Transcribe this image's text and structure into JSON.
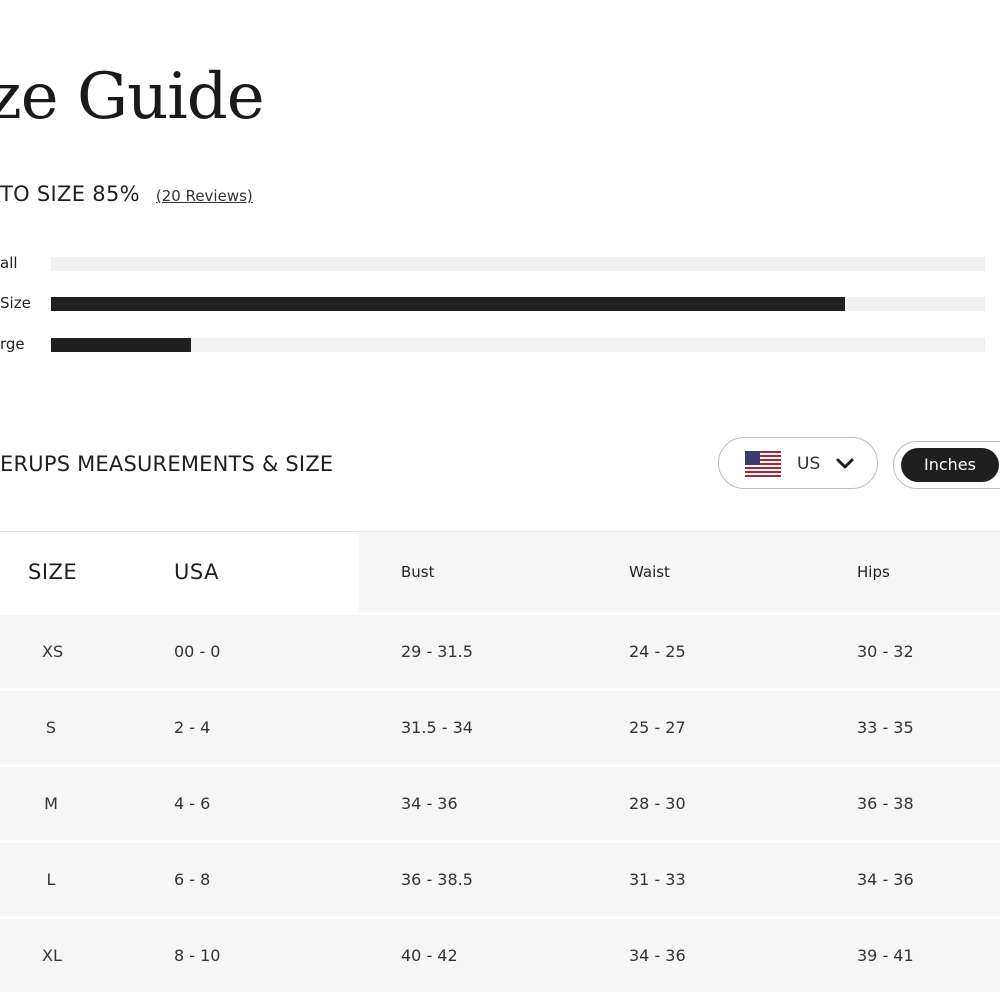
{
  "page": {
    "title": "ze Guide"
  },
  "fit": {
    "heading": "TO SIZE 85%",
    "reviews_link": "(20 Reviews)",
    "bars": [
      {
        "label": "all",
        "value": 0
      },
      {
        "label": "Size",
        "value": 0.85
      },
      {
        "label": "rge",
        "value": 0.15
      }
    ]
  },
  "measurements": {
    "heading": "ERUPS MEASUREMENTS & SIZE",
    "region": {
      "selected": "US",
      "flag_icon": "us-flag-icon"
    },
    "units": {
      "active": "Inches"
    }
  },
  "table": {
    "headers": {
      "size": "SIZE",
      "usa": "USA",
      "bust": "Bust",
      "waist": "Waist",
      "hips": "Hips"
    },
    "rows": [
      {
        "size": "XS",
        "usa": "00 - 0",
        "bust": "29 - 31.5",
        "waist": "24 - 25",
        "hips": "30 - 32"
      },
      {
        "size": "S",
        "usa": "2 - 4",
        "bust": "31.5 - 34",
        "waist": "25 - 27",
        "hips": "33 - 35"
      },
      {
        "size": "M",
        "usa": "4 - 6",
        "bust": "34 - 36",
        "waist": "28 - 30",
        "hips": "36 - 38"
      },
      {
        "size": "L",
        "usa": "6 - 8",
        "bust": "36 - 38.5",
        "waist": "31 - 33",
        "hips": "34 - 36"
      },
      {
        "size": "XL",
        "usa": "8 - 10",
        "bust": "40 - 42",
        "waist": "34 - 36",
        "hips": "39 - 41"
      }
    ]
  },
  "colors": {
    "text": "#222222",
    "bar_fill": "#1f1f1f",
    "bar_track": "#f2f2f2",
    "row_bg": "#f6f6f6",
    "toggle_active": "#1f1f1f"
  }
}
